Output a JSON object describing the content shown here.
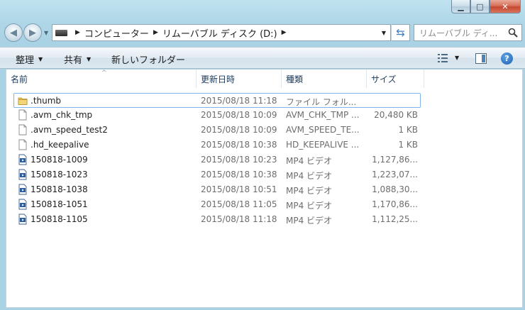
{
  "window": {
    "address": {
      "crumbs": [
        "コンピューター",
        "リムーバブル ディスク (D:)"
      ]
    },
    "search": {
      "placeholder": "リムーバブル ディ..."
    }
  },
  "toolbar": {
    "organize_label": "整理",
    "share_label": "共有",
    "new_folder_label": "新しいフォルダー"
  },
  "columns": [
    "名前",
    "更新日時",
    "種類",
    "サイズ"
  ],
  "files": [
    {
      "name": ".thumb",
      "date": "2015/08/18 11:18",
      "type": "ファイル フォル...",
      "size": "",
      "icon": "folder-icon"
    },
    {
      "name": ".avm_chk_tmp",
      "date": "2015/08/18 10:09",
      "type": "AVM_CHK_TMP ...",
      "size": "20,480 KB",
      "icon": "file-icon"
    },
    {
      "name": ".avm_speed_test2",
      "date": "2015/08/18 10:09",
      "type": "AVM_SPEED_TE...",
      "size": "1 KB",
      "icon": "file-icon"
    },
    {
      "name": ".hd_keepalive",
      "date": "2015/08/18 10:38",
      "type": "HD_KEEPALIVE ...",
      "size": "1 KB",
      "icon": "file-icon"
    },
    {
      "name": "150818-1009",
      "date": "2015/08/18 10:23",
      "type": "MP4 ビデオ",
      "size": "1,127,86...",
      "icon": "video-file-icon"
    },
    {
      "name": "150818-1023",
      "date": "2015/08/18 10:38",
      "type": "MP4 ビデオ",
      "size": "1,223,07...",
      "icon": "video-file-icon"
    },
    {
      "name": "150818-1038",
      "date": "2015/08/18 10:51",
      "type": "MP4 ビデオ",
      "size": "1,088,30...",
      "icon": "video-file-icon"
    },
    {
      "name": "150818-1051",
      "date": "2015/08/18 11:05",
      "type": "MP4 ビデオ",
      "size": "1,170,86...",
      "icon": "video-file-icon"
    },
    {
      "name": "150818-1105",
      "date": "2015/08/18 11:18",
      "type": "MP4 ビデオ",
      "size": "1,112,25...",
      "icon": "video-file-icon"
    }
  ],
  "colors": {
    "selection_border": "#7eb4ea",
    "header_text": "#1e3a5a",
    "secondary_text": "#6d6d6d"
  }
}
